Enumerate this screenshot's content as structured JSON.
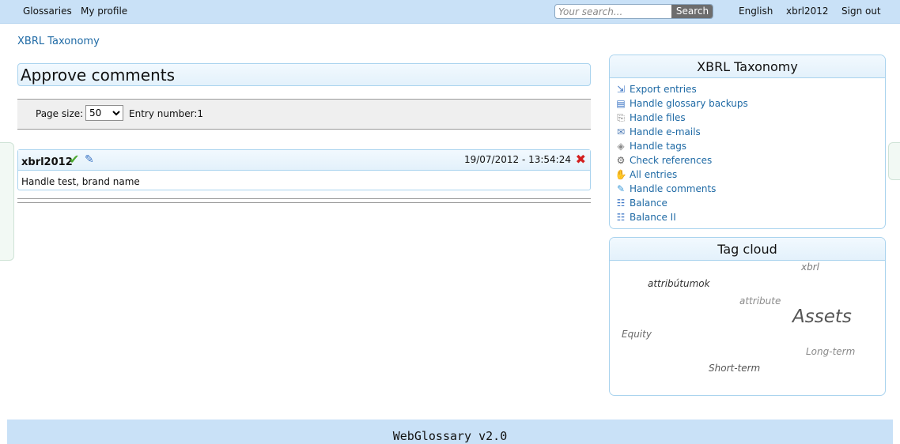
{
  "topbar": {
    "nav": [
      "Glossaries",
      "My profile"
    ],
    "search": {
      "placeholder": "Your search...",
      "value": "",
      "button_label": "Search"
    },
    "right": {
      "language": "English",
      "user": "xbrl2012",
      "signout": "Sign out"
    }
  },
  "breadcrumb": "XBRL Taxonomy",
  "page_title": "Approve comments",
  "pager": {
    "page_size_label": "Page size:",
    "page_size_value": "50",
    "entry_number": "Entry number:1"
  },
  "comment": {
    "user": "xbrl2012",
    "date": "19/07/2012 - 13:54:24",
    "text": "Handle test, brand name",
    "icons": {
      "approve": "check-icon",
      "edit": "pencil-icon",
      "delete": "delete-x-icon"
    }
  },
  "menu_panel": {
    "title": "XBRL Taxonomy",
    "items": [
      {
        "label": "Export entries",
        "icon": "export-icon",
        "glyph": "⇲",
        "color": "#3a74c4"
      },
      {
        "label": "Handle glossary backups",
        "icon": "backup-icon",
        "glyph": "▤",
        "color": "#3a74c4"
      },
      {
        "label": "Handle files",
        "icon": "files-icon",
        "glyph": "⎘",
        "color": "#888888"
      },
      {
        "label": "Handle e-mails",
        "icon": "mail-icon",
        "glyph": "✉",
        "color": "#4a78b5"
      },
      {
        "label": "Handle tags",
        "icon": "tag-icon",
        "glyph": "◈",
        "color": "#8a8a8a"
      },
      {
        "label": "Check references",
        "icon": "references-icon",
        "glyph": "⚙",
        "color": "#666666"
      },
      {
        "label": "All entries",
        "icon": "entries-icon",
        "glyph": "✋",
        "color": "#d9a400"
      },
      {
        "label": "Handle comments",
        "icon": "comments-icon",
        "glyph": "✎",
        "color": "#3a9ad9"
      },
      {
        "label": "Balance",
        "icon": "hierarchy-icon",
        "glyph": "☷",
        "color": "#3a74c4"
      },
      {
        "label": "Balance II",
        "icon": "hierarchy-icon",
        "glyph": "☷",
        "color": "#3a74c4"
      }
    ]
  },
  "tag_cloud": {
    "title": "Tag cloud",
    "tags": [
      "xbrl",
      "attribútumok",
      "attribute",
      "Assets",
      "Equity",
      "Long-term",
      "Short-term"
    ]
  },
  "footer": "WebGlossary v2.0",
  "colors": {
    "topbar": "#c9e1f7",
    "link": "#1f6aa5",
    "border": "#a9d3ee"
  }
}
